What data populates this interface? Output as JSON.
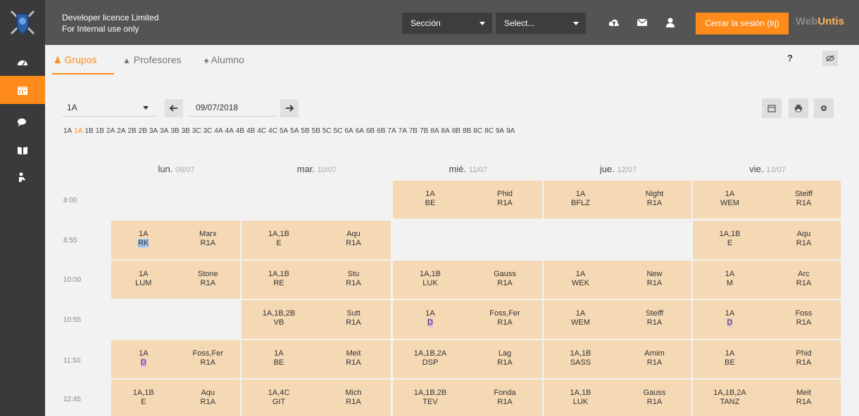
{
  "header": {
    "licence_line1": "Developer licence Limited",
    "licence_line2": "For Internal use only",
    "section_select": "Sección",
    "select_placeholder": "Select...",
    "logout": "Cerrar la sesión (lrj)",
    "brand_web": "Web",
    "brand_untis": "Untis"
  },
  "tabs": [
    {
      "label": "Grupos",
      "icon": "group-icon"
    },
    {
      "label": "Profesores",
      "icon": "graduation-cap-icon"
    },
    {
      "label": "Alumno",
      "icon": "student-icon"
    }
  ],
  "help_label": "?",
  "toolbar": {
    "class_value": "1A",
    "date_value": "09/07/2018"
  },
  "class_list": [
    "1A",
    "1A",
    "1B",
    "1B",
    "2A",
    "2A",
    "2B",
    "2B",
    "3A",
    "3A",
    "3B",
    "3B",
    "3C",
    "3C",
    "4A",
    "4A",
    "4B",
    "4B",
    "4C",
    "4C",
    "5A",
    "5A",
    "5B",
    "5B",
    "5C",
    "5C",
    "6A",
    "6A",
    "6B",
    "6B",
    "7A",
    "7A",
    "7B",
    "7B",
    "8A",
    "8A",
    "8B",
    "8B",
    "8C",
    "8C",
    "9A",
    "9A"
  ],
  "days": [
    {
      "name": "lun.",
      "date": "09/07"
    },
    {
      "name": "mar.",
      "date": "10/07"
    },
    {
      "name": "mié.",
      "date": "11/07"
    },
    {
      "name": "jue.",
      "date": "12/07"
    },
    {
      "name": "vie.",
      "date": "13/07"
    }
  ],
  "times": [
    "8:00",
    "8:55",
    "10:00",
    "10:55",
    "11:50",
    "12:45"
  ],
  "lessons": {
    "r0d2": {
      "group": "1A",
      "subject": "BE",
      "teacher": "Phid",
      "room": "R1A"
    },
    "r0d3": {
      "group": "1A",
      "subject": "BFLZ",
      "teacher": "Night",
      "room": "R1A"
    },
    "r0d4": {
      "group": "1A",
      "subject": "WEM",
      "teacher": "Steiff",
      "room": "R1A"
    },
    "r1d0": {
      "group": "1A",
      "subject": "RK",
      "teacher": "Marx",
      "room": "R1A"
    },
    "r1d1": {
      "group": "1A,1B",
      "subject": "E",
      "teacher": "Aqu",
      "room": "R1A"
    },
    "r1d4": {
      "group": "1A,1B",
      "subject": "E",
      "teacher": "Aqu",
      "room": "R1A"
    },
    "r2d0": {
      "group": "1A",
      "subject": "LUM",
      "teacher": "Stone",
      "room": "R1A"
    },
    "r2d1": {
      "group": "1A,1B",
      "subject": "RE",
      "teacher": "Stu",
      "room": "R1A"
    },
    "r2d2": {
      "group": "1A,1B",
      "subject": "LUK",
      "teacher": "Gauss",
      "room": "R1A"
    },
    "r2d3": {
      "group": "1A",
      "subject": "WEK",
      "teacher": "New",
      "room": "R1A"
    },
    "r2d4": {
      "group": "1A",
      "subject": "M",
      "teacher": "Arc",
      "room": "R1A"
    },
    "r3d1": {
      "group": "1A,1B,2B",
      "subject": "VB",
      "teacher": "Sutt",
      "room": "R1A"
    },
    "r3d2": {
      "group": "1A",
      "subject": "D",
      "teacher": "Foss,Fer",
      "room": "R1A"
    },
    "r3d3": {
      "group": "1A",
      "subject": "WEM",
      "teacher": "Steiff",
      "room": "R1A"
    },
    "r3d4": {
      "group": "1A",
      "subject": "D",
      "teacher": "Foss",
      "room": "R1A"
    },
    "r4d0": {
      "group": "1A",
      "subject": "D",
      "teacher": "Foss,Fer",
      "room": "R1A"
    },
    "r4d1": {
      "group": "1A",
      "subject": "BE",
      "teacher": "Meit",
      "room": "R1A"
    },
    "r4d2": {
      "group": "1A,1B,2A",
      "subject": "DSP",
      "teacher": "Lag",
      "room": "R1A"
    },
    "r4d3": {
      "group": "1A,1B",
      "subject": "SASS",
      "teacher": "Arnim",
      "room": "R1A"
    },
    "r4d4": {
      "group": "1A",
      "subject": "BE",
      "teacher": "Phid",
      "room": "R1A"
    },
    "r5d0": {
      "group": "1A,1B",
      "subject": "E",
      "teacher": "Aqu",
      "room": "R1A"
    },
    "r5d1": {
      "group": "1A,4C",
      "subject": "GIT",
      "teacher": "Mich",
      "room": "R1A"
    },
    "r5d2": {
      "group": "1A,1B,2B",
      "subject": "TEV",
      "teacher": "Fonda",
      "room": "R1A"
    },
    "r5d3": {
      "group": "1A,1B",
      "subject": "LUK",
      "teacher": "Gauss",
      "room": "R1A"
    },
    "r5d4": {
      "group": "1A,1B,2A",
      "subject": "TANZ",
      "teacher": "Meit",
      "room": "R1A"
    }
  },
  "colors": {
    "accent": "#ff8c1a",
    "lesson_bg": "#f5d9b4",
    "highlight_blue": "#9bc3f0",
    "highlight_pink": "#dcb0e6"
  }
}
